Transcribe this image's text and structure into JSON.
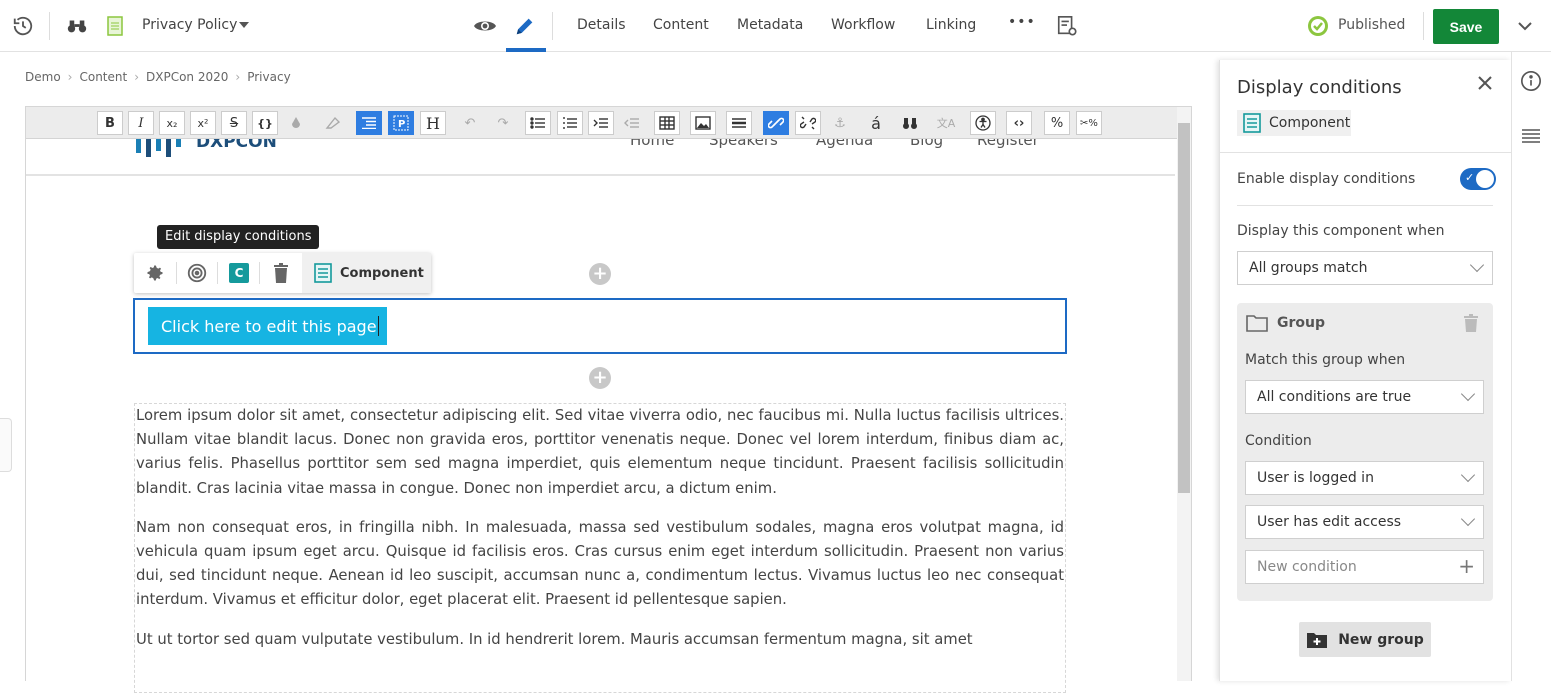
{
  "topbar": {
    "document_title": "Privacy Policy",
    "tabs": [
      "Details",
      "Content",
      "Metadata",
      "Workflow",
      "Linking"
    ],
    "more_label": "•••",
    "status": "Published",
    "save_label": "Save",
    "colors": {
      "accent": "#1d6ac4",
      "save": "#138738",
      "published": "#8cc63f"
    }
  },
  "breadcrumb": [
    "Demo",
    "Content",
    "DXPCon 2020",
    "Privacy"
  ],
  "rte_toolbar": {
    "bold": "B",
    "italic": "I",
    "subscript": "x₂",
    "superscript": "x²",
    "strike": "S",
    "code": "{}",
    "heading": "H",
    "special_char": "á",
    "percent": "%",
    "cut_percent": "✂%"
  },
  "site_header": {
    "logo_text": "DXPCON",
    "nav": [
      "Home",
      "Speakers",
      "Agenda",
      "Blog",
      "Register"
    ]
  },
  "canvas": {
    "tooltip": "Edit display conditions",
    "component_label": "Component",
    "component_badge": "C",
    "cta_label": "Click here to edit this page",
    "paragraphs": [
      "Lorem ipsum dolor sit amet, consectetur adipiscing elit. Sed vitae viverra odio, nec faucibus mi. Nulla luctus facilisis ultrices. Nullam vitae blandit lacus. Donec non gravida eros, porttitor venenatis neque. Donec vel lorem interdum, finibus diam ac, varius felis. Phasellus porttitor sem sed magna imperdiet, quis elementum neque tincidunt. Praesent facilisis sollicitudin blandit. Cras lacinia vitae massa in congue. Donec non imperdiet arcu, a dictum enim.",
      "Nam non consequat eros, in fringilla nibh. In malesuada, massa sed vestibulum sodales, magna eros volutpat magna, id vehicula quam ipsum eget arcu. Quisque id facilisis eros. Cras cursus enim eget interdum sollicitudin. Praesent non varius dui, sed tincidunt neque. Aenean id leo suscipit, accumsan nunc a, condimentum lectus. Vivamus luctus leo nec consequat interdum. Vivamus et efficitur dolor, eget placerat elit. Praesent id pellentesque sapien.",
      "Ut ut tortor sed quam vulputate vestibulum. In id hendrerit lorem. Mauris accumsan fermentum magna, sit amet"
    ]
  },
  "panel": {
    "title": "Display conditions",
    "chip_label": "Component",
    "enable_label": "Enable display conditions",
    "enabled": true,
    "display_when_label": "Display this component when",
    "display_when_value": "All groups match",
    "group": {
      "title": "Group",
      "match_label": "Match this group when",
      "match_value": "All conditions are true",
      "condition_label": "Condition",
      "conditions": [
        "User is logged in",
        "User has edit access"
      ],
      "new_condition_placeholder": "New condition"
    },
    "new_group_label": "New group"
  }
}
